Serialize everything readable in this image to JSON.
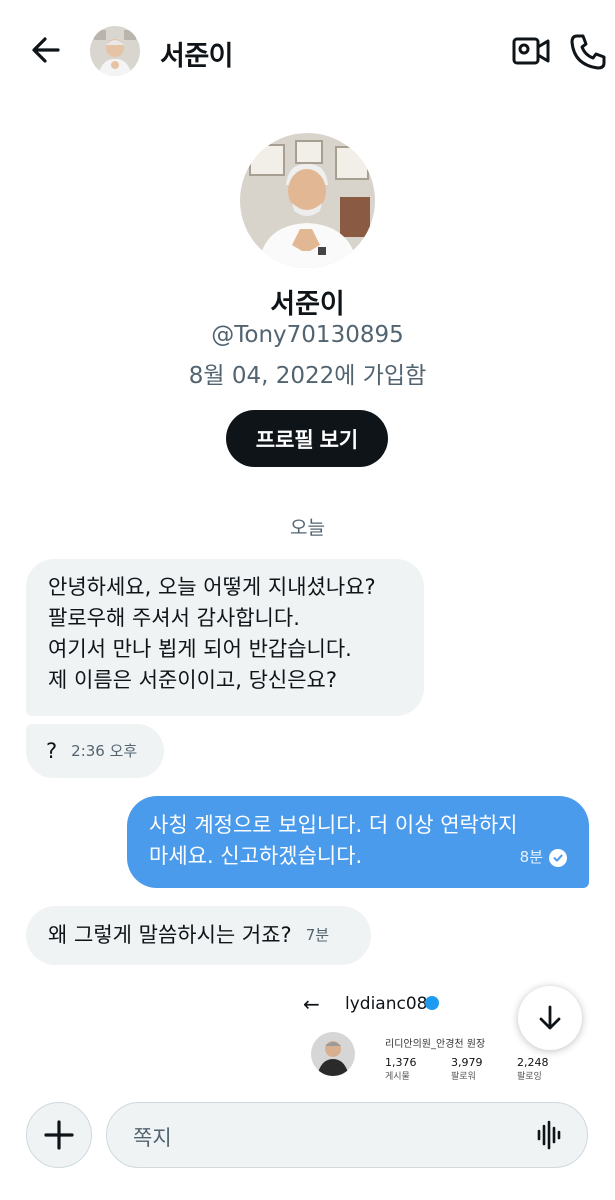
{
  "header": {
    "name": "서준이",
    "back_icon": "arrow-left-icon",
    "video_icon": "video-camera-icon",
    "call_icon": "phone-icon"
  },
  "profile": {
    "name": "서준이",
    "handle": "@Tony70130895",
    "joined": "8월 04, 2022에 가입함",
    "view_profile_label": "프로필 보기"
  },
  "date_separator": "오늘",
  "messages": [
    {
      "direction": "incoming",
      "lines": [
        "안녕하세요, 오늘 어떻게 지내셨나요?",
        "팔로우해 주셔서 감사합니다.",
        "여기서 만나 뵙게 되어 반갑습니다.",
        "제 이름은 서준이이고, 당신은요?"
      ],
      "time": ""
    },
    {
      "direction": "incoming",
      "text": "?",
      "time": "2:36 오후"
    },
    {
      "direction": "outgoing",
      "lines": [
        "사칭 계정으로 보입니다. 더 이상 연락하지",
        "마세요. 신고하겠습니다."
      ],
      "time": "8분",
      "status": "read"
    },
    {
      "direction": "incoming",
      "text": "왜 그렇게 말씀하시는 거죠?",
      "time": "7분"
    }
  ],
  "shared_screenshot": {
    "username": "lydianc08",
    "bio": "리디안의원_안경천 원장",
    "stats": [
      {
        "value": "1,376",
        "label": "게시물"
      },
      {
        "value": "3,979",
        "label": "팔로워"
      },
      {
        "value": "2,248",
        "label": "팔로잉"
      }
    ]
  },
  "composer": {
    "placeholder": "쪽지",
    "add_icon": "plus-icon",
    "voice_icon": "voice-wave-icon"
  },
  "colors": {
    "accent": "#1d9bf0",
    "outgoing_bubble": "#4a9bec",
    "incoming_bubble": "#eff3f4",
    "text": "#0f1419",
    "muted": "#536471"
  }
}
